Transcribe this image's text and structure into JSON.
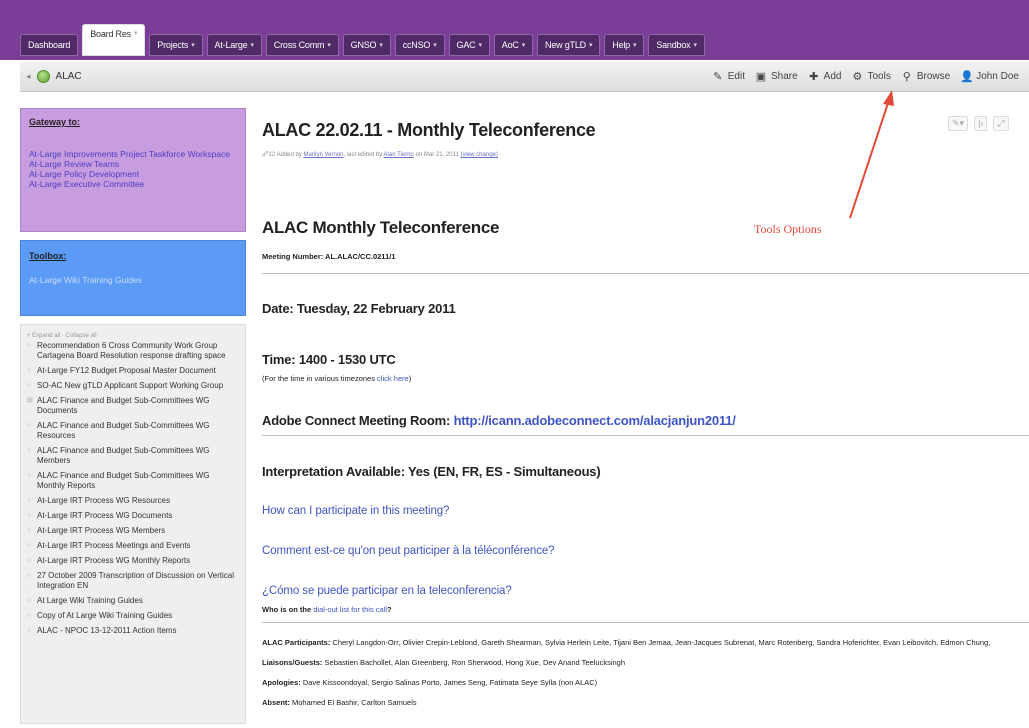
{
  "nav": {
    "tabs": [
      {
        "label": "Dashboard",
        "caret": false,
        "active": false
      },
      {
        "label": "Board Res",
        "caret": true,
        "active": true
      },
      {
        "label": "Projects",
        "caret": true,
        "active": false
      },
      {
        "label": "At-Large",
        "caret": true,
        "active": false
      },
      {
        "label": "Cross Comm",
        "caret": true,
        "active": false
      },
      {
        "label": "GNSO",
        "caret": true,
        "active": false
      },
      {
        "label": "ccNSO",
        "caret": true,
        "active": false
      },
      {
        "label": "GAC",
        "caret": true,
        "active": false
      },
      {
        "label": "AoC",
        "caret": true,
        "active": false
      },
      {
        "label": "New gTLD",
        "caret": true,
        "active": false
      },
      {
        "label": "Help",
        "caret": true,
        "active": false
      },
      {
        "label": "Sandbox",
        "caret": true,
        "active": false
      }
    ]
  },
  "toolbar": {
    "breadcrumb": "ALAC",
    "actions": {
      "edit": "Edit",
      "share": "Share",
      "add": "Add",
      "tools": "Tools",
      "browse": "Browse",
      "user": "John Doe"
    }
  },
  "sidebar": {
    "gateway": {
      "title": "Gateway to:",
      "links": [
        "At-Large Improvements Project Taskforce Workspace",
        "At-Large Review Teams",
        "At-Large Policy Development",
        "At-Large Executive Committee"
      ]
    },
    "toolbox": {
      "title": "Toolbox:",
      "links": [
        "At-Large Wiki Training Guides"
      ]
    },
    "tree": {
      "controls": "+ Expand all · Collapse all",
      "items": [
        "Recommendation 6 Cross Community Work Group Cartagena Board Resolution response drafting space",
        "At-Large FY12 Budget Proposal Master Document",
        "SO-AC New gTLD Applicant Support Working Group",
        "ALAC Finance and Budget Sub-Committees WG Documents",
        "ALAC Finance and Budget Sub-Committees WG Resources",
        "ALAC Finance and Budget Sub-Committees WG Members",
        "ALAC Finance and Budget Sub-Committees WG Monthly Reports",
        "At-Large IRT Process WG Resources",
        "At-Large IRT Process WG Documents",
        "At-Large IRT Process WG Members",
        "At-Large IRT Process Meetings and Events",
        "At-Large IRT Process WG Monthly Reports",
        "27 October 2009 Transcription of Discussion on Vertical Integration EN",
        "At Large Wiki Training Guides",
        "Copy of At Large Wiki Training Guides",
        "ALAC - NPOC 13-12-2011 Action Items"
      ]
    }
  },
  "page": {
    "title": "ALAC 22.02.11 - Monthly Teleconference",
    "byline_count": "12",
    "byline_added": "Added by",
    "byline_author": "Marilyn Vernon",
    "byline_mid": ", last edited by",
    "byline_editor": "Alan Tierno",
    "byline_date": "on Mar 21, 2011",
    "byline_change": "(view change)",
    "heading": "ALAC Monthly Teleconference",
    "meeting_number": "Meeting Number: AL.ALAC/CC.0211/1",
    "date": "Date: Tuesday, 22 February 2011",
    "time": "Time: 1400 - 1530 UTC",
    "timezones_prefix": "(For the time in various timezones ",
    "timezones_link": "click here",
    "timezones_suffix": ")",
    "adobe_label": "Adobe Connect Meeting Room: ",
    "adobe_link": "http://icann.adobeconnect.com/alacjanjun2011/",
    "interpretation": "Interpretation Available: Yes (EN, FR, ES - Simultaneous)",
    "q_en": "How can I participate in this meeting?",
    "q_fr": "Comment est-ce qu'on peut participer à la téléconférence?",
    "q_es": "¿Cómo se puede participar en la teleconferencia?",
    "who_prefix": "Who is on the ",
    "who_link": "dial-out list for this call",
    "who_suffix": "?",
    "participants_label": "ALAC Participants:",
    "participants": " Cheryl Langdon-Orr, Olivier Crepin-Leblond, Gareth Shearman, Sylvia Herlein Leite, Tijani Ben Jemaa, Jean-Jacques Subrenat, Marc Rotenberg, Sandra Hoferichter, Evan Leibovitch, Edmon Chung,",
    "liaisons_label": "Liaisons/Guests:",
    "liaisons": " Sebastien Bachollet, Alan Greenberg, Ron Sherwood, Hong Xue, Dev Anand Teelucksingh",
    "apologies_label": "Apologies:",
    "apologies": " Dave Kissoondoyal, Sergio Salinas Porto, James Seng, Fatimata Seye Sylla (non ALAC)",
    "absent_label": "Absent:",
    "absent": " Mohamed El Bashir, Carlton Samuels"
  },
  "annotation": {
    "label": "Tools Options",
    "color": "#e04a3a"
  },
  "colors": {
    "nav_bg": "#7a3d98",
    "gateway_bg": "#c89de0",
    "toolbox_bg": "#5b9af5",
    "link": "#3f55c4"
  }
}
